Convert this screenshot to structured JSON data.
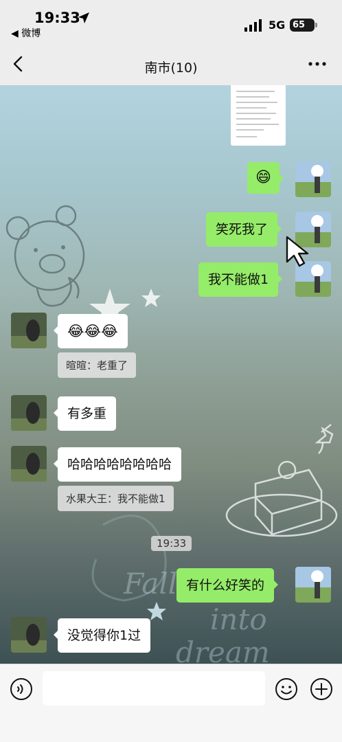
{
  "status_bar": {
    "time": "19:33",
    "back_app": "◀ 微博",
    "network": "5G",
    "battery": "65"
  },
  "nav": {
    "title": "南市(10)"
  },
  "messages": {
    "m1_text": "😄",
    "m2_text": "笑死我了",
    "m3_text": "我不能做1",
    "m4_text": "😂😂😂",
    "m4_quote": "暄暄：老重了",
    "m5_text": "有多重",
    "m6_text": "哈哈哈哈哈哈哈哈",
    "m6_quote": "水果大王：我不能做1",
    "timestamp": "19:33",
    "m7_text": "有什么好笑的",
    "m8_text": "没觉得你1过"
  },
  "input": {
    "placeholder": ""
  },
  "colors": {
    "outgoing_bubble": "#95ec69",
    "incoming_bubble": "#ffffff",
    "bar_background": "#ededed"
  },
  "icons": [
    "location-arrow-icon",
    "signal-icon",
    "back-arrow-icon",
    "more-icon",
    "voice-icon",
    "emoji-icon",
    "plus-icon",
    "cursor-icon"
  ]
}
